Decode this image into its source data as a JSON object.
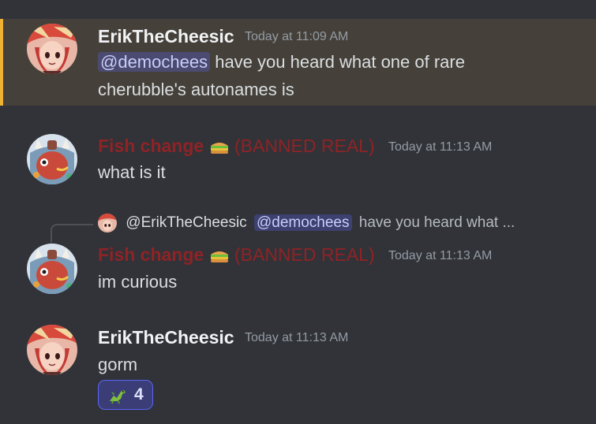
{
  "messages": [
    {
      "author": "ErikTheCheesic",
      "timestamp": "Today at 11:09 AM",
      "mention": "@demochees",
      "text_line1": "have you heard what one of rare",
      "text_line2": "cherubble's autonames is",
      "highlighted": true
    },
    {
      "author": "Fish change",
      "author_suffix": "(BANNED REAL)",
      "timestamp": "Today at 11:13 AM",
      "text": "what is it"
    },
    {
      "reply": {
        "author": "@ErikTheCheesic",
        "mention": "@demochees",
        "preview": "have you heard what ..."
      },
      "author": "Fish change",
      "author_suffix": "(BANNED REAL)",
      "timestamp": "Today at 11:13 AM",
      "text": "im curious"
    },
    {
      "author": "ErikTheCheesic",
      "timestamp": "Today at 11:13 AM",
      "text": "gorm",
      "reaction": {
        "emoji": "dinosaur-emoji",
        "count": "4"
      }
    }
  ],
  "colors": {
    "background": "#313338",
    "highlight_bg": "#45413a",
    "highlight_bar": "#f0b232",
    "erik_name": "#f2f3f5",
    "fish_name": "#8f2326",
    "mention_bg": "#3c4270",
    "reaction_border": "#5865f2"
  }
}
